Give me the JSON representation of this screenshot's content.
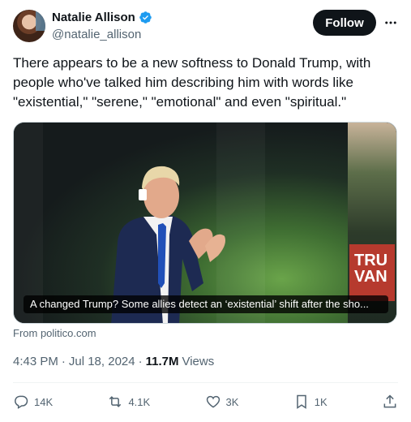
{
  "author": {
    "display_name": "Natalie Allison",
    "handle": "@natalie_allison",
    "verified": true
  },
  "follow_label": "Follow",
  "tweet_text": "There appears to be a new softness to Donald Trump, with people who've talked him describing him with words like \"existential,\" \"serene,\" \"emotional\" and even \"spiritual.\"",
  "media": {
    "caption": "A changed Trump? Some allies detect an ‘existential’ shift after the sho...",
    "sign_text": "TRU VAN"
  },
  "link_source": "From politico.com",
  "meta": {
    "time": "4:43 PM",
    "separator1": "·",
    "date": "Jul 18, 2024",
    "separator2": "·",
    "views_count": "11.7M",
    "views_label": "Views"
  },
  "actions": {
    "reply_count": "14K",
    "retweet_count": "4.1K",
    "like_count": "3K",
    "bookmark_count": "1K"
  },
  "colors": {
    "text_primary": "#0f1419",
    "text_secondary": "#536471",
    "verified_blue": "#1d9bf0",
    "follow_bg": "#0f1419"
  },
  "icons": [
    "verified-badge-icon",
    "more-icon",
    "reply-icon",
    "retweet-icon",
    "like-icon",
    "bookmark-icon",
    "share-icon"
  ]
}
